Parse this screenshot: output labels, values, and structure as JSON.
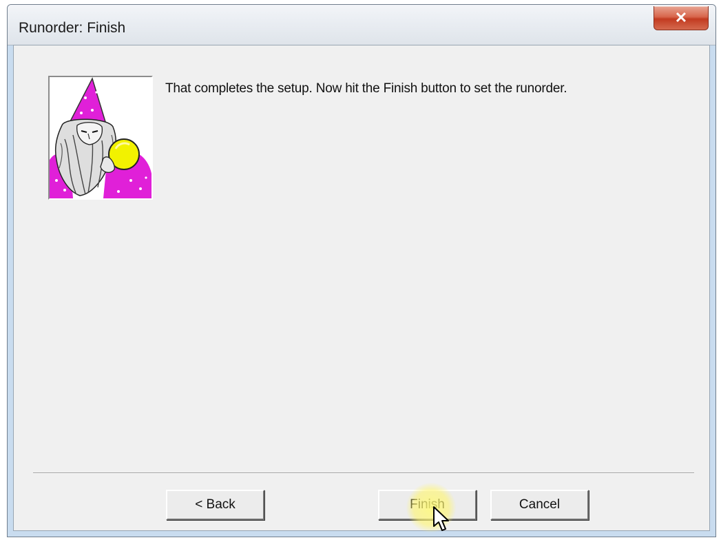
{
  "window": {
    "title": "Runorder: Finish",
    "close_glyph": "✕"
  },
  "content": {
    "image_icon": "wizard-icon",
    "message": "That completes the setup. Now hit the Finish button to set the runorder."
  },
  "buttons": {
    "back_label": "< Back",
    "finish_label": "Finish",
    "cancel_label": "Cancel"
  },
  "colors": {
    "wizard_robe": "#e020d8",
    "crystal_ball": "#f2f200",
    "close_button": "#c94a30"
  }
}
